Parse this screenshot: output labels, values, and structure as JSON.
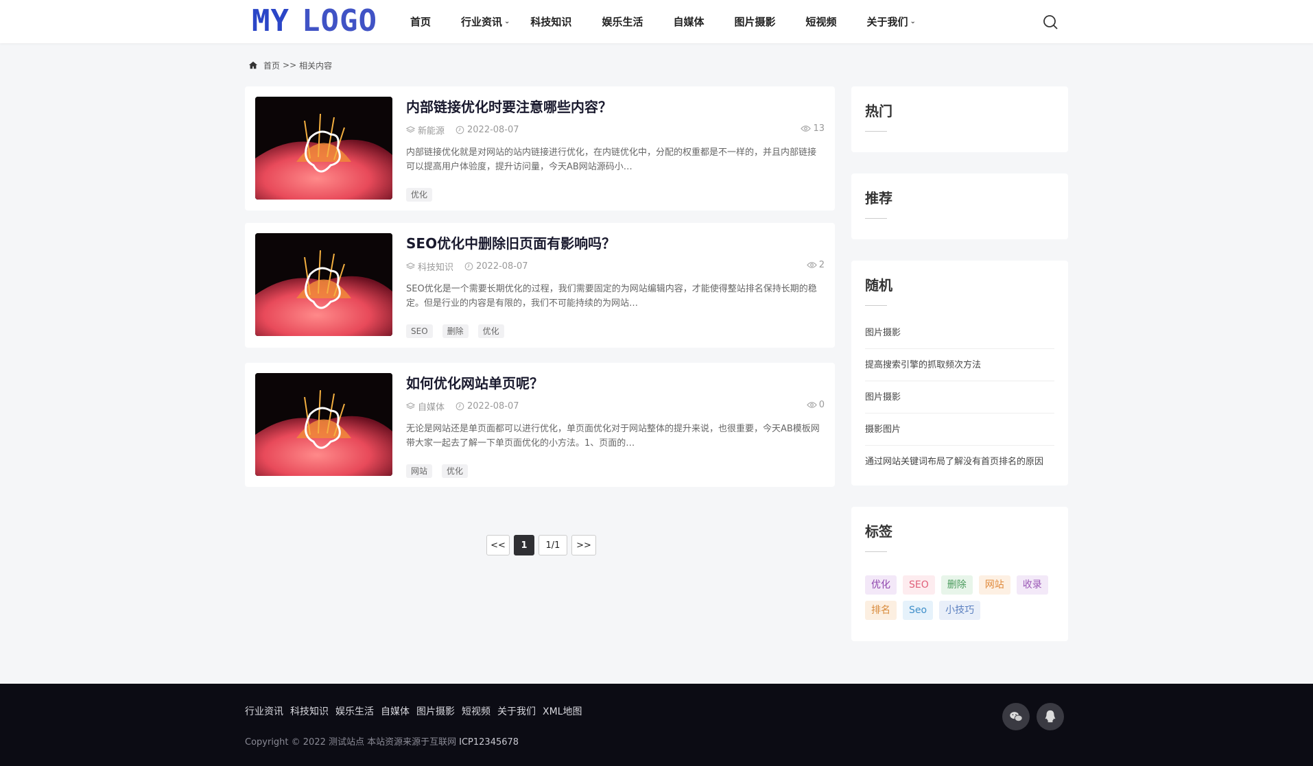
{
  "header": {
    "logo_left": "MY",
    "logo_right": "LOGO",
    "nav": [
      {
        "label": "首页",
        "dropdown": false
      },
      {
        "label": "行业资讯",
        "dropdown": true
      },
      {
        "label": "科技知识",
        "dropdown": false
      },
      {
        "label": "娱乐生活",
        "dropdown": false
      },
      {
        "label": "自媒体",
        "dropdown": false
      },
      {
        "label": "图片摄影",
        "dropdown": false
      },
      {
        "label": "短视频",
        "dropdown": false
      },
      {
        "label": "关于我们",
        "dropdown": true
      }
    ]
  },
  "breadcrumb": {
    "home": "首页",
    "separator": ">>",
    "current": "相关内容"
  },
  "articles": [
    {
      "title": "内部链接优化时要注意哪些内容？",
      "category": "新能源",
      "date": "2022-08-07",
      "views": "13",
      "excerpt": "内部链接优化就是对网站的站内链接进行优化，在内链优化中，分配的权重都是不一样的，并且内部链接可以提高用户体验度，提升访问量，今天AB网站源码小…",
      "tags": [
        "优化"
      ]
    },
    {
      "title": "SEO优化中删除旧页面有影响吗？",
      "category": "科技知识",
      "date": "2022-08-07",
      "views": "2",
      "excerpt": "SEO优化是一个需要长期优化的过程，我们需要固定的为网站编辑内容，才能使得整站排名保持长期的稳定。但是行业的内容是有限的，我们不可能持续的为网站…",
      "tags": [
        "SEO",
        "删除",
        "优化"
      ]
    },
    {
      "title": "如何优化网站单页呢？",
      "category": "自媒体",
      "date": "2022-08-07",
      "views": "0",
      "excerpt": "无论是网站还是单页面都可以进行优化，单页面优化对于网站整体的提升来说，也很重要，今天AB模板网带大家一起去了解一下单页面优化的小方法。1、页面的…",
      "tags": [
        "网站",
        "优化"
      ]
    }
  ],
  "pagination": {
    "prev": "<<",
    "current": "1",
    "info": "1/1",
    "next": ">>"
  },
  "sidebar": {
    "hot": {
      "title": "热门"
    },
    "recommend": {
      "title": "推荐"
    },
    "random": {
      "title": "随机",
      "items": [
        "图片摄影",
        "提高搜索引擎的抓取频次方法",
        "图片摄影",
        "摄影图片",
        "通过网站关键词布局了解没有首页排名的原因"
      ]
    },
    "tags": {
      "title": "标签",
      "items": [
        {
          "label": "优化",
          "color": "#8e44ad",
          "bg": "#f3e8f8"
        },
        {
          "label": "SEO",
          "color": "#e0607a",
          "bg": "#fdecef"
        },
        {
          "label": "删除",
          "color": "#4a9a5c",
          "bg": "#e8f5ea"
        },
        {
          "label": "网站",
          "color": "#e08a3c",
          "bg": "#fdf0e3"
        },
        {
          "label": "收录",
          "color": "#9b59b6",
          "bg": "#f3e9f8"
        },
        {
          "label": "排名",
          "color": "#d88a3a",
          "bg": "#fcefe1"
        },
        {
          "label": "Seo",
          "color": "#3f8fc9",
          "bg": "#e6f2fb"
        },
        {
          "label": "小技巧",
          "color": "#5a7fbf",
          "bg": "#e9eff9"
        }
      ]
    }
  },
  "footer": {
    "links": [
      "行业资讯",
      "科技知识",
      "娱乐生活",
      "自媒体",
      "图片摄影",
      "短视频",
      "关于我们",
      "XML地图"
    ],
    "copyright": "Copyright © 2022 测试站点 本站资源来源于互联网",
    "icp": "ICP12345678"
  },
  "colors": {
    "logo": "#2b46c7",
    "footer_bg": "#0c0c14",
    "page_bg": "#f5f6f8"
  }
}
